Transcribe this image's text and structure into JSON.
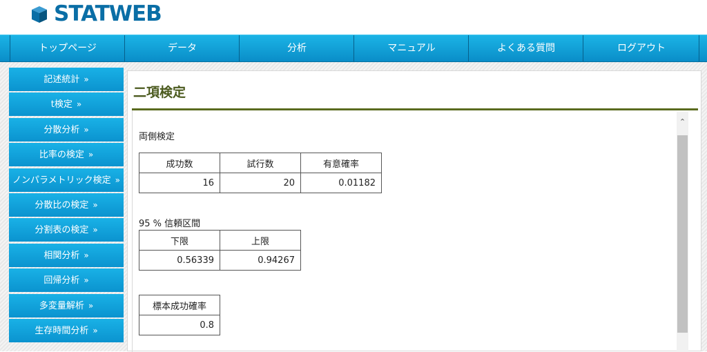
{
  "brand": {
    "name": "STATWEB",
    "color": "#0a6ea6"
  },
  "nav": {
    "items": [
      "トップページ",
      "データ",
      "分析",
      "マニュアル",
      "よくある質問",
      "ログアウト"
    ]
  },
  "sidebar": {
    "arrow": "»",
    "items": [
      "記述統計",
      "t検定",
      "分散分析",
      "比率の検定",
      "ノンパラメトリック検定",
      "分散比の検定",
      "分割表の検定",
      "相関分析",
      "回帰分析",
      "多変量解析",
      "生存時間分析"
    ]
  },
  "main": {
    "title": "二項検定",
    "test_type": "両側検定",
    "result_table": {
      "headers": [
        "成功数",
        "試行数",
        "有意確率"
      ],
      "values": [
        "16",
        "20",
        "0.01182"
      ]
    },
    "ci_label": "95 % 信頼区間",
    "ci_table": {
      "headers": [
        "下限",
        "上限"
      ],
      "values": [
        "0.56339",
        "0.94267"
      ]
    },
    "prob_table": {
      "headers": [
        "標本成功確率"
      ],
      "values": [
        "0.8"
      ]
    }
  },
  "colors": {
    "accent": "#0b93cf",
    "title": "#4b5a1e"
  }
}
